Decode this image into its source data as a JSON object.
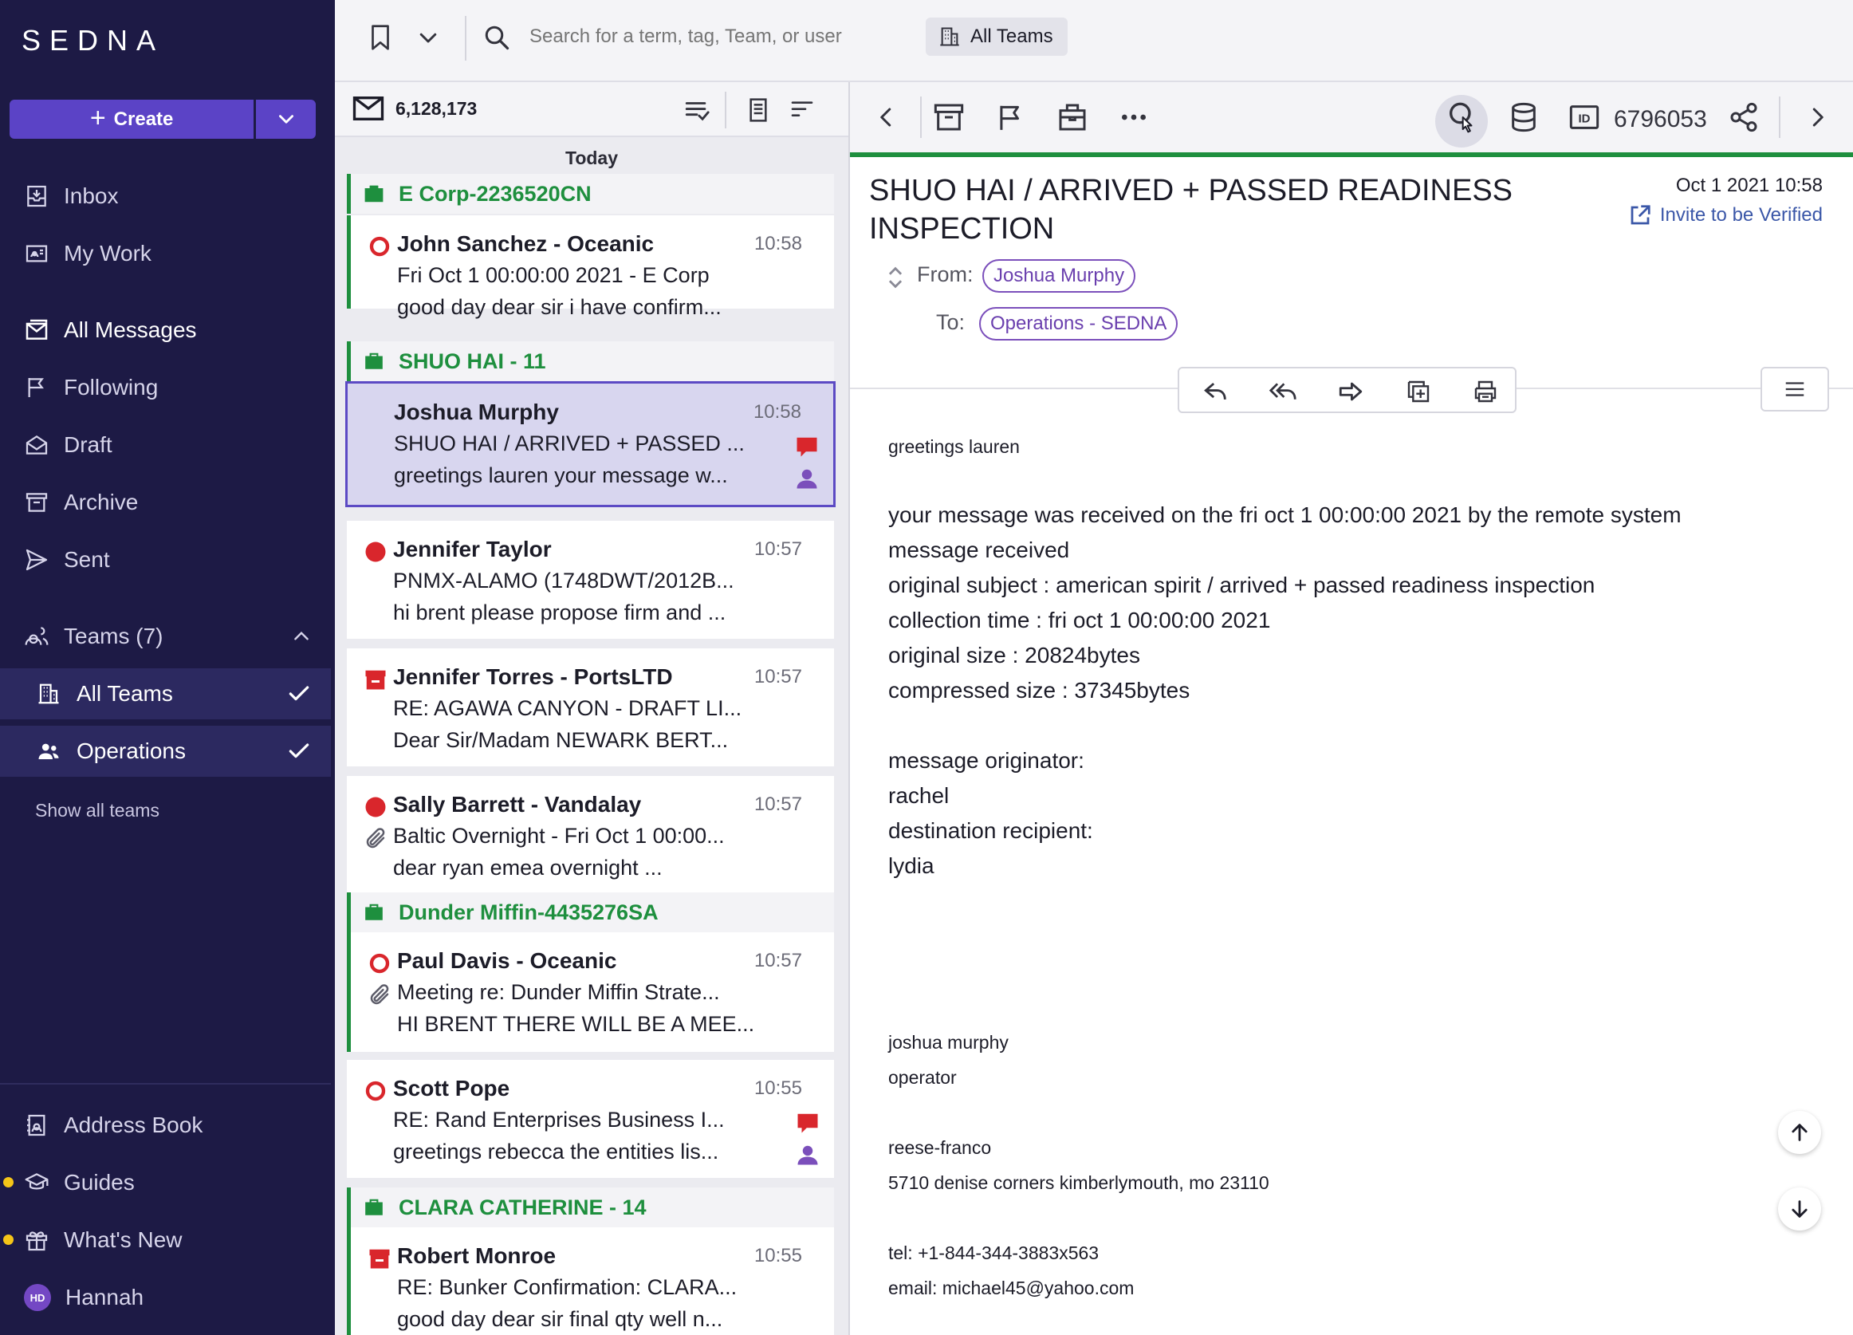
{
  "brand": {
    "logo": "SEDNA"
  },
  "sidebar": {
    "create_label": "Create",
    "nav": [
      {
        "label": "Inbox",
        "icon": "inbox-icon"
      },
      {
        "label": "My Work",
        "icon": "my-work-icon"
      },
      {
        "label": "All Messages",
        "icon": "all-messages-icon",
        "active": true
      },
      {
        "label": "Following",
        "icon": "flag-icon"
      },
      {
        "label": "Draft",
        "icon": "draft-icon"
      },
      {
        "label": "Archive",
        "icon": "archive-icon"
      },
      {
        "label": "Sent",
        "icon": "sent-icon"
      }
    ],
    "teams_label": "Teams (7)",
    "teams": [
      {
        "label": "All Teams",
        "checked": true
      },
      {
        "label": "Operations",
        "checked": true
      }
    ],
    "show_all_teams": "Show all teams",
    "bottom": [
      {
        "label": "Address Book"
      },
      {
        "label": "Guides",
        "dot": true
      },
      {
        "label": "What's New",
        "dot": true
      },
      {
        "label": "Hannah",
        "avatar_initials": "HD"
      }
    ]
  },
  "topbar": {
    "search_placeholder": "Search for a term, tag, Team, or user",
    "team_filter": "All Teams"
  },
  "list": {
    "count": "6,128,173",
    "day_label": "Today",
    "groups": [
      {
        "name": "E Corp-2236520CN"
      },
      {
        "name": "SHUO HAI - 11"
      },
      {
        "name": "Dunder Miffin-4435276SA"
      },
      {
        "name": "CLARA CATHERINE - 14"
      }
    ],
    "messages": [
      {
        "sender": "John Sanchez - Oceanic",
        "time": "10:58",
        "subject": "Fri Oct 1 00:00:00 2021 - E Corp",
        "preview": "good day dear sir i have confirm...",
        "status": "open-circle"
      },
      {
        "sender": "Joshua Murphy",
        "time": "10:58",
        "subject": "SHUO HAI / ARRIVED + PASSED ...",
        "preview": "greetings lauren your message w...",
        "status": "none",
        "flag": true,
        "user": true,
        "selected": true
      },
      {
        "sender": "Jennifer Taylor",
        "time": "10:57",
        "subject": "PNMX-ALAMO (1748DWT/2012B...",
        "preview": "hi brent please propose firm and ...",
        "status": "filled-circle"
      },
      {
        "sender": "Jennifer Torres - PortsLTD",
        "time": "10:57",
        "subject": "RE: AGAWA CANYON - DRAFT LI...",
        "preview": "Dear Sir/Madam NEWARK BERT...",
        "status": "archive-red"
      },
      {
        "sender": "Sally Barrett - Vandalay",
        "time": "10:57",
        "subject": "Baltic Overnight - Fri Oct 1 00:00...",
        "preview": "dear ryan emea overnight ...",
        "status": "filled-circle",
        "attachment": true
      },
      {
        "sender": "Paul Davis - Oceanic",
        "time": "10:57",
        "subject": "Meeting re: Dunder Miffin Strate...",
        "preview": "HI BRENT THERE WILL BE A MEE...",
        "status": "open-circle",
        "attachment": true
      },
      {
        "sender": "Scott Pope",
        "time": "10:55",
        "subject": "RE: Rand Enterprises Business I...",
        "preview": "greetings rebecca the entities lis...",
        "status": "open-circle",
        "flag": true,
        "user": true
      },
      {
        "sender": "Robert Monroe",
        "time": "10:55",
        "subject": "RE: Bunker Confirmation: CLARA...",
        "preview": "good day dear sir final qty well n...",
        "status": "archive-red"
      }
    ]
  },
  "detail": {
    "message_id": "6796053",
    "subject": "SHUO HAI / ARRIVED + PASSED READINESS INSPECTION",
    "date": "Oct 1 2021 10:58",
    "invite_label": "Invite to be Verified",
    "from_label": "From:",
    "from": "Joshua Murphy",
    "to_label": "To:",
    "to": "Operations - SEDNA",
    "body": {
      "greeting": "greetings lauren",
      "lines": [
        "your message was received on the fri oct 1 00:00:00 2021 by the remote system",
        "message received",
        "original subject : american spirit / arrived + passed readiness inspection",
        "collection time : fri oct 1 00:00:00 2021",
        "original size : 20824bytes",
        "compressed size : 37345bytes"
      ],
      "lines2": [
        "message originator:",
        "rachel",
        "destination recipient:",
        "lydia"
      ],
      "signature": [
        "joshua murphy",
        "operator",
        "reese-franco",
        "5710 denise corners kimberlymouth, mo 23110",
        "tel: +1-844-344-3883x563",
        "email: michael45@yahoo.com"
      ]
    }
  },
  "colors": {
    "sidebar_bg": "#1d1a45",
    "accent": "#5b43c6",
    "group_green": "#1e8f3e",
    "status_red": "#d9262c",
    "pill_purple": "#7b4fbb"
  }
}
